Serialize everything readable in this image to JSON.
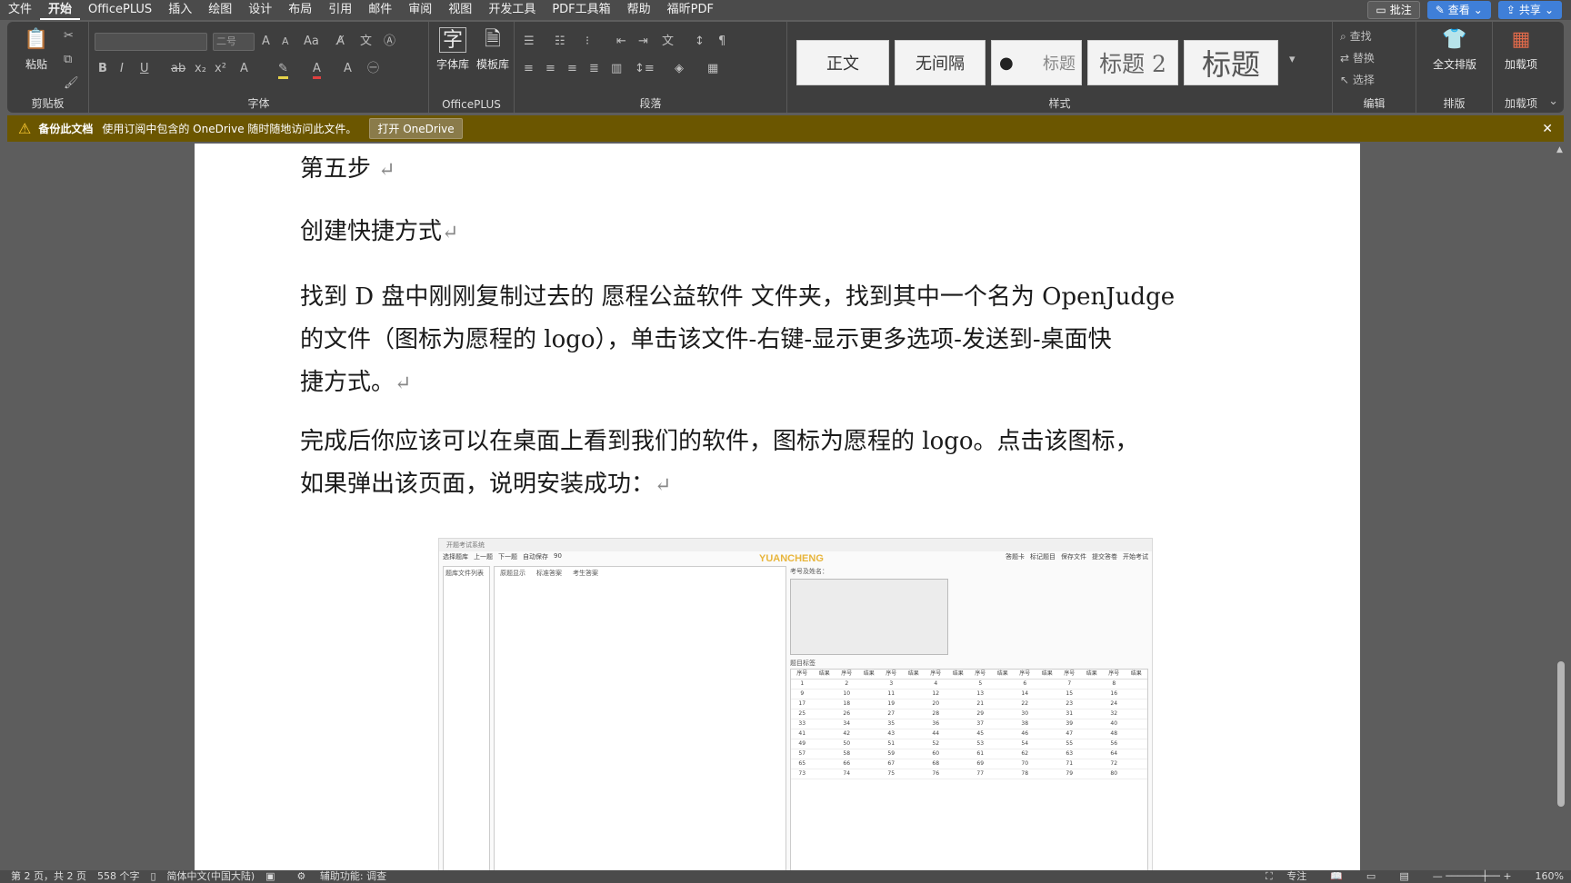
{
  "menu": [
    "文件",
    "开始",
    "OfficePLUS",
    "插入",
    "绘图",
    "设计",
    "布局",
    "引用",
    "邮件",
    "审阅",
    "视图",
    "开发工具",
    "PDF工具箱",
    "帮助",
    "福昕PDF"
  ],
  "menu_active_index": 1,
  "topbar": {
    "comment_btn": "批注",
    "edit_btn": "查看",
    "share_btn": "共享"
  },
  "ribbon": {
    "clipboard": {
      "paste": "粘贴",
      "label": "剪贴板"
    },
    "font": {
      "label": "字体",
      "name_value": "",
      "size_value": "二号"
    },
    "officeplus": {
      "btn1": "字体库",
      "btn2": "模板库",
      "label": "OfficePLUS"
    },
    "paragraph": {
      "label": "段落"
    },
    "styles": {
      "label": "样式",
      "items": [
        "正文",
        "无间隔",
        "标题",
        "标题 2",
        "标题"
      ]
    },
    "editing": {
      "find": "查找",
      "replace": "替换",
      "select": "选择",
      "label": "编辑"
    },
    "layout": {
      "btn": "全文排版",
      "label": "排版"
    },
    "addins": {
      "btn": "加载项",
      "label": "加载项"
    }
  },
  "infobar": {
    "title": "备份此文档",
    "message": "使用订阅中包含的 OneDrive 随时随地访问此文件。",
    "button": "打开 OneDrive"
  },
  "doc": {
    "p1": "第五步",
    "p2": "创建快捷方式",
    "p3a": "找到 D 盘中刚刚复制过去的 愿程公益软件  文件夹，找到其中一个名为 OpenJudge",
    "p3b": "的文件（图标为愿程的 logo），单击该文件-右键-显示更多选项-发送到-桌面快",
    "p3c": "捷方式。",
    "p4a": "完成后你应该可以在桌面上看到我们的软件，图标为愿程的 logo。点击该图标，",
    "p4b": "如果弹出该页面，说明安装成功：",
    "return_mark": "↵"
  },
  "embedded": {
    "title": "开题考试系统",
    "brand": "YUANCHENG",
    "toolbar": [
      "选择题库",
      "上一题",
      "下一题",
      "自动保存",
      "90"
    ],
    "right_toolbar": [
      "答题卡",
      "标记题目",
      "保存文件",
      "提交答卷",
      "开始考试"
    ],
    "left_tab": "题库文件列表",
    "mid_tabs": [
      "原题显示",
      "标准答案",
      "考生答案"
    ],
    "name_label": "考号及姓名：",
    "table_title": "题目标签",
    "col_headers": [
      "序号",
      "结果",
      "序号",
      "结果",
      "序号",
      "结果",
      "序号",
      "结果",
      "序号",
      "结果",
      "序号",
      "结果",
      "序号",
      "结果",
      "序号",
      "结果"
    ],
    "numbers": [
      1,
      2,
      3,
      4,
      5,
      6,
      7,
      8,
      9,
      10,
      11,
      12,
      13,
      14,
      15,
      16,
      17,
      18,
      19,
      20,
      21,
      22,
      23,
      24,
      25,
      26,
      27,
      28,
      29,
      30,
      31,
      32,
      33,
      34,
      35,
      36,
      37,
      38,
      39,
      40,
      41,
      42,
      43,
      44,
      45,
      46,
      47,
      48,
      49,
      50,
      51,
      52,
      53,
      54,
      55,
      56,
      57,
      58,
      59,
      60,
      61,
      62,
      63,
      64,
      65,
      66,
      67,
      68,
      69,
      70,
      71,
      72,
      73,
      74,
      75,
      76,
      77,
      78,
      79,
      80
    ]
  },
  "status": {
    "page": "第 2 页，共 2 页",
    "words": "558 个字",
    "lang": "简体中文(中国大陆)",
    "accessibility": "辅助功能: 调查",
    "focus": "专注",
    "zoom": "160%"
  }
}
